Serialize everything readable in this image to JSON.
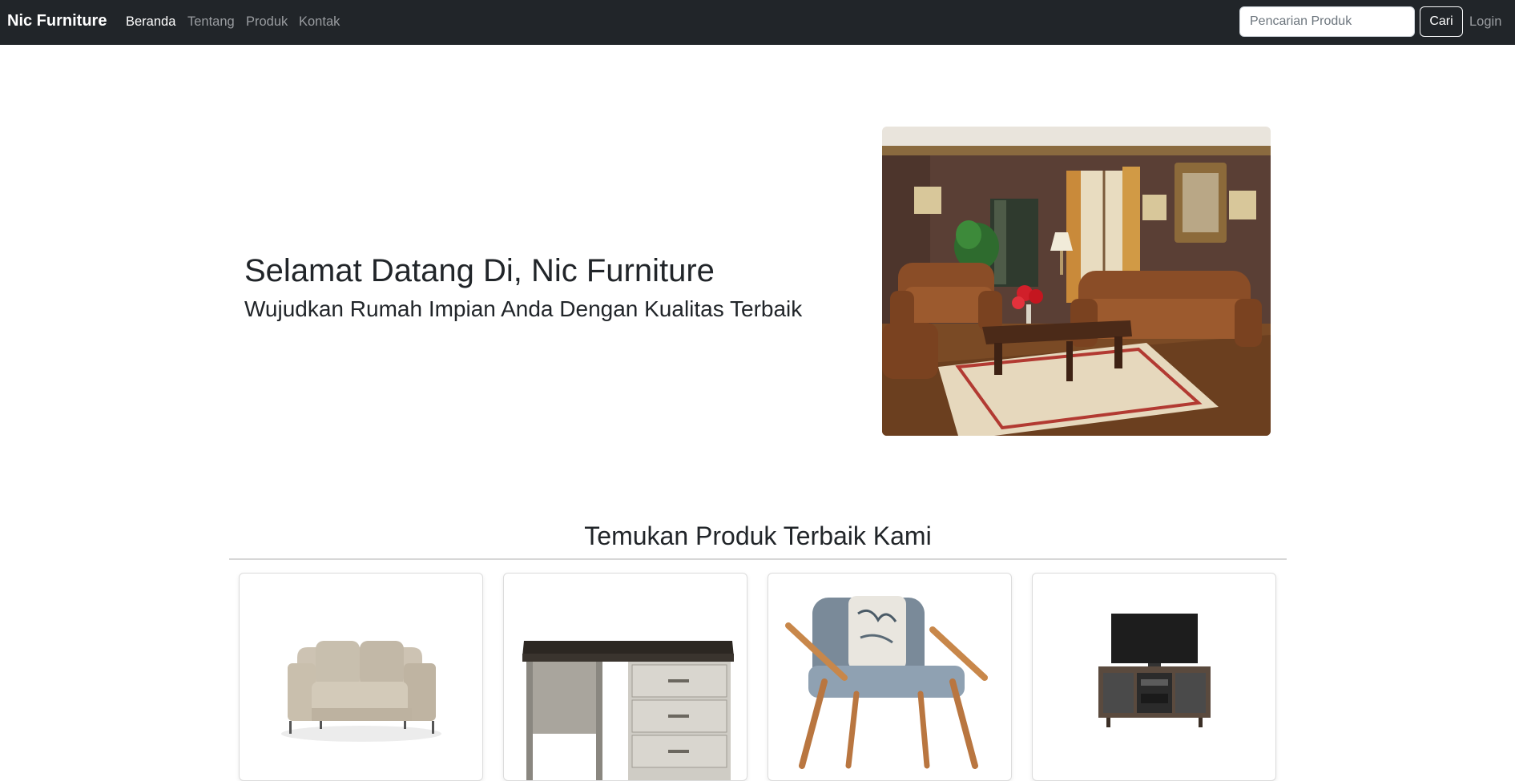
{
  "navbar": {
    "brand": "Nic Furniture",
    "links": [
      "Beranda",
      "Tentang",
      "Produk",
      "Kontak"
    ],
    "active_link": "Beranda",
    "search": {
      "placeholder": "Pencarian Produk",
      "value": ""
    },
    "search_button": "Cari",
    "login": "Login"
  },
  "hero": {
    "title": "Selamat Datang Di, Nic Furniture",
    "subtitle": "Wujudkan Rumah Impian Anda Dengan Kualitas Terbaik",
    "image_icon": "living-room-photo"
  },
  "products_section": {
    "title": "Temukan Produk Terbaik Kami",
    "products": [
      {
        "icon": "sofa-photo"
      },
      {
        "icon": "desk-photo"
      },
      {
        "icon": "armchair-photo"
      },
      {
        "icon": "tv-stand-photo"
      }
    ]
  },
  "colors": {
    "navbar_bg": "#212529",
    "nav_active": "#ffffff",
    "nav_muted": "#9a9da1"
  }
}
